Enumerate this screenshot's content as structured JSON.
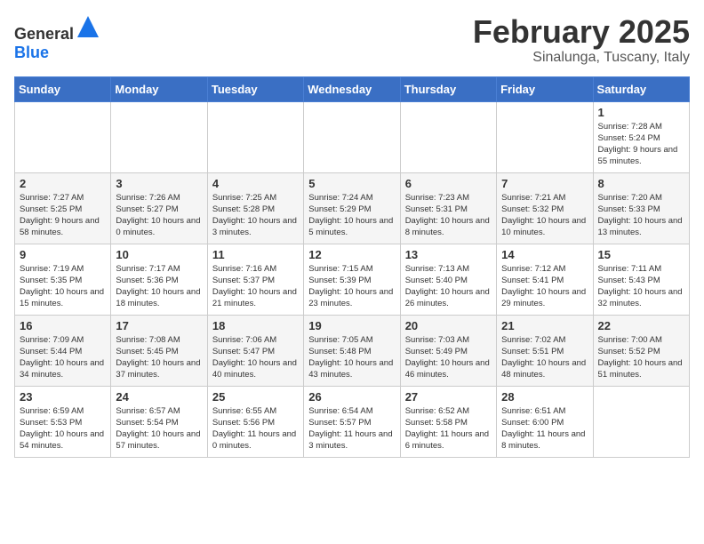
{
  "header": {
    "logo_general": "General",
    "logo_blue": "Blue",
    "month": "February 2025",
    "location": "Sinalunga, Tuscany, Italy"
  },
  "days_of_week": [
    "Sunday",
    "Monday",
    "Tuesday",
    "Wednesday",
    "Thursday",
    "Friday",
    "Saturday"
  ],
  "weeks": [
    [
      {
        "day": "",
        "info": ""
      },
      {
        "day": "",
        "info": ""
      },
      {
        "day": "",
        "info": ""
      },
      {
        "day": "",
        "info": ""
      },
      {
        "day": "",
        "info": ""
      },
      {
        "day": "",
        "info": ""
      },
      {
        "day": "1",
        "info": "Sunrise: 7:28 AM\nSunset: 5:24 PM\nDaylight: 9 hours and 55 minutes."
      }
    ],
    [
      {
        "day": "2",
        "info": "Sunrise: 7:27 AM\nSunset: 5:25 PM\nDaylight: 9 hours and 58 minutes."
      },
      {
        "day": "3",
        "info": "Sunrise: 7:26 AM\nSunset: 5:27 PM\nDaylight: 10 hours and 0 minutes."
      },
      {
        "day": "4",
        "info": "Sunrise: 7:25 AM\nSunset: 5:28 PM\nDaylight: 10 hours and 3 minutes."
      },
      {
        "day": "5",
        "info": "Sunrise: 7:24 AM\nSunset: 5:29 PM\nDaylight: 10 hours and 5 minutes."
      },
      {
        "day": "6",
        "info": "Sunrise: 7:23 AM\nSunset: 5:31 PM\nDaylight: 10 hours and 8 minutes."
      },
      {
        "day": "7",
        "info": "Sunrise: 7:21 AM\nSunset: 5:32 PM\nDaylight: 10 hours and 10 minutes."
      },
      {
        "day": "8",
        "info": "Sunrise: 7:20 AM\nSunset: 5:33 PM\nDaylight: 10 hours and 13 minutes."
      }
    ],
    [
      {
        "day": "9",
        "info": "Sunrise: 7:19 AM\nSunset: 5:35 PM\nDaylight: 10 hours and 15 minutes."
      },
      {
        "day": "10",
        "info": "Sunrise: 7:17 AM\nSunset: 5:36 PM\nDaylight: 10 hours and 18 minutes."
      },
      {
        "day": "11",
        "info": "Sunrise: 7:16 AM\nSunset: 5:37 PM\nDaylight: 10 hours and 21 minutes."
      },
      {
        "day": "12",
        "info": "Sunrise: 7:15 AM\nSunset: 5:39 PM\nDaylight: 10 hours and 23 minutes."
      },
      {
        "day": "13",
        "info": "Sunrise: 7:13 AM\nSunset: 5:40 PM\nDaylight: 10 hours and 26 minutes."
      },
      {
        "day": "14",
        "info": "Sunrise: 7:12 AM\nSunset: 5:41 PM\nDaylight: 10 hours and 29 minutes."
      },
      {
        "day": "15",
        "info": "Sunrise: 7:11 AM\nSunset: 5:43 PM\nDaylight: 10 hours and 32 minutes."
      }
    ],
    [
      {
        "day": "16",
        "info": "Sunrise: 7:09 AM\nSunset: 5:44 PM\nDaylight: 10 hours and 34 minutes."
      },
      {
        "day": "17",
        "info": "Sunrise: 7:08 AM\nSunset: 5:45 PM\nDaylight: 10 hours and 37 minutes."
      },
      {
        "day": "18",
        "info": "Sunrise: 7:06 AM\nSunset: 5:47 PM\nDaylight: 10 hours and 40 minutes."
      },
      {
        "day": "19",
        "info": "Sunrise: 7:05 AM\nSunset: 5:48 PM\nDaylight: 10 hours and 43 minutes."
      },
      {
        "day": "20",
        "info": "Sunrise: 7:03 AM\nSunset: 5:49 PM\nDaylight: 10 hours and 46 minutes."
      },
      {
        "day": "21",
        "info": "Sunrise: 7:02 AM\nSunset: 5:51 PM\nDaylight: 10 hours and 48 minutes."
      },
      {
        "day": "22",
        "info": "Sunrise: 7:00 AM\nSunset: 5:52 PM\nDaylight: 10 hours and 51 minutes."
      }
    ],
    [
      {
        "day": "23",
        "info": "Sunrise: 6:59 AM\nSunset: 5:53 PM\nDaylight: 10 hours and 54 minutes."
      },
      {
        "day": "24",
        "info": "Sunrise: 6:57 AM\nSunset: 5:54 PM\nDaylight: 10 hours and 57 minutes."
      },
      {
        "day": "25",
        "info": "Sunrise: 6:55 AM\nSunset: 5:56 PM\nDaylight: 11 hours and 0 minutes."
      },
      {
        "day": "26",
        "info": "Sunrise: 6:54 AM\nSunset: 5:57 PM\nDaylight: 11 hours and 3 minutes."
      },
      {
        "day": "27",
        "info": "Sunrise: 6:52 AM\nSunset: 5:58 PM\nDaylight: 11 hours and 6 minutes."
      },
      {
        "day": "28",
        "info": "Sunrise: 6:51 AM\nSunset: 6:00 PM\nDaylight: 11 hours and 8 minutes."
      },
      {
        "day": "",
        "info": ""
      }
    ]
  ]
}
